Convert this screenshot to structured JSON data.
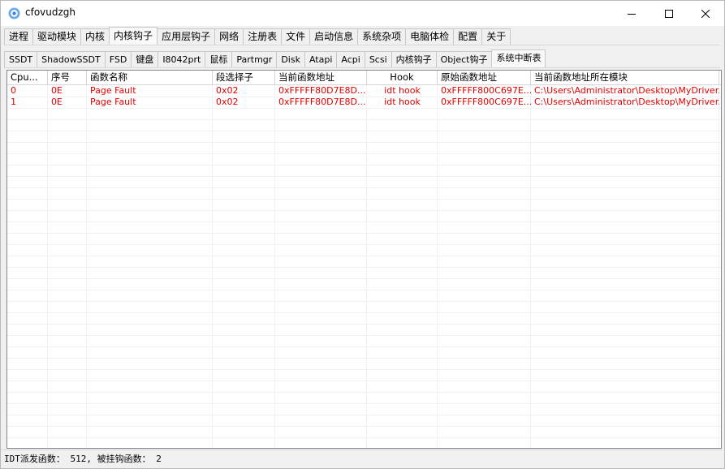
{
  "window": {
    "title": "cfovudzgh"
  },
  "main_tabs": [
    "进程",
    "驱动模块",
    "内核",
    "内核钩子",
    "应用层钩子",
    "网络",
    "注册表",
    "文件",
    "启动信息",
    "系统杂项",
    "电脑体检",
    "配置",
    "关于"
  ],
  "main_active": "内核钩子",
  "sub_tabs": [
    "SSDT",
    "ShadowSSDT",
    "FSD",
    "键盘",
    "I8042prt",
    "鼠标",
    "Partmgr",
    "Disk",
    "Atapi",
    "Acpi",
    "Scsi",
    "内核钩子",
    "Object钩子",
    "系统中断表"
  ],
  "sub_active": "系统中断表",
  "columns": [
    "Cpu...",
    "序号",
    "函数名称",
    "段选择子",
    "当前函数地址",
    "Hook",
    "原始函数地址",
    "当前函数地址所在模块"
  ],
  "rows": [
    [
      "0",
      "0E",
      "Page Fault",
      "0x02",
      "0xFFFFF80D7E8D...",
      "idt hook",
      "0xFFFFF800C697E...",
      "C:\\Users\\Administrator\\Desktop\\MyDriver...."
    ],
    [
      "1",
      "0E",
      "Page Fault",
      "0x02",
      "0xFFFFF80D7E8D...",
      "idt hook",
      "0xFFFFF800C697E...",
      "C:\\Users\\Administrator\\Desktop\\MyDriver...."
    ]
  ],
  "status": "IDT派发函数： 512, 被挂钩函数： 2",
  "colors": {
    "hook_row_text": "#e00000",
    "window_bg": "#f0f0f0"
  }
}
